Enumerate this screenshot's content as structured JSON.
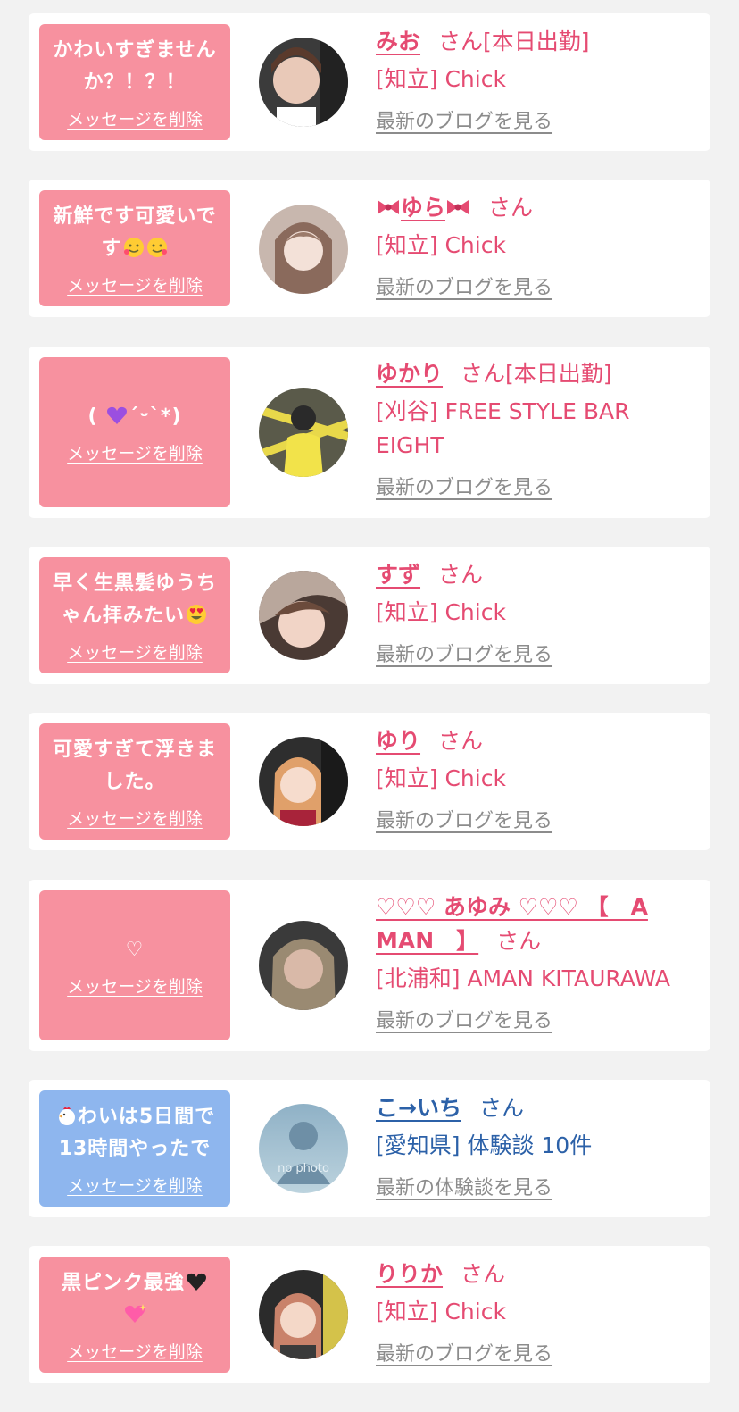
{
  "colors": {
    "background": "#f2f2f2",
    "card": "#ffffff",
    "bubble_pink": "#f7919f",
    "bubble_blue": "#8eb6ee",
    "accent_pink": "#e54b72",
    "accent_blue": "#2c61a8",
    "link_gray": "#8c8c8c"
  },
  "cards": [
    {
      "message_lines": [
        "かわいすぎません",
        "か？！？！"
      ],
      "delete_label": "メッセージを削除",
      "name": "みお",
      "san_label": "さん[本日出勤]",
      "shop_lines": [
        "[知立] Chick"
      ],
      "blog_label": "最新のブログを見る",
      "avatar_icon": "photo-avatar"
    },
    {
      "message_lines": [
        "新鮮です可愛いで",
        "す"
      ],
      "message_emoji": "smiling-face-with-hearts x2",
      "delete_label": "メッセージを削除",
      "name": "ゆら",
      "name_decor": "ribbon-bow-icon",
      "san_label": "さん",
      "shop_lines": [
        "[知立] Chick"
      ],
      "blog_label": "最新のブログを見る",
      "avatar_icon": "photo-avatar"
    },
    {
      "message_lines": [
        "(   ´ᵕ`*)"
      ],
      "message_emoji": "purple-heart-icon",
      "delete_label": "メッセージを削除",
      "name": "ゆかり",
      "san_label": "さん[本日出勤]",
      "shop_lines": [
        "[刈谷] FREE STYLE BAR",
        "EIGHT"
      ],
      "blog_label": "最新のブログを見る",
      "avatar_icon": "photo-avatar"
    },
    {
      "message_lines": [
        "早く生黒髪ゆうち",
        "ゃん拝みたい"
      ],
      "message_emoji": "heart-eyes-icon",
      "delete_label": "メッセージを削除",
      "name": "すず",
      "san_label": "さん",
      "shop_lines": [
        "[知立] Chick"
      ],
      "blog_label": "最新のブログを見る",
      "avatar_icon": "photo-avatar"
    },
    {
      "message_lines": [
        "可愛すぎて浮きま",
        "した。"
      ],
      "delete_label": "メッセージを削除",
      "name": "ゆり",
      "san_label": "さん",
      "shop_lines": [
        "[知立] Chick"
      ],
      "blog_label": "最新のブログを見る",
      "avatar_icon": "photo-avatar"
    },
    {
      "message_lines": [
        "♡"
      ],
      "delete_label": "メッセージを削除",
      "name_lines": [
        "♡♡♡ あゆみ ♡♡♡ 【　A",
        "MAN　】"
      ],
      "san_label": "さん",
      "shop_lines": [
        "[北浦和] AMAN KITAURAWA"
      ],
      "blog_label": "最新のブログを見る",
      "avatar_icon": "photo-avatar"
    },
    {
      "message_lines": [
        "わいは5日間で",
        "13時間やったで"
      ],
      "message_emoji": "rooster-icon",
      "delete_label": "メッセージを削除",
      "name": "こ→いち",
      "san_label": "さん",
      "shop_lines": [
        "[愛知県] 体験談 10件"
      ],
      "blog_label": "最新の体験談を見る",
      "avatar_caption": "no photo",
      "avatar_icon": "no-photo-silhouette"
    },
    {
      "message_lines": [
        "黒ピンク最強",
        ""
      ],
      "message_emoji": "black-heart + sparkling-heart",
      "delete_label": "メッセージを削除",
      "name": "りりか",
      "san_label": "さん",
      "shop_lines": [
        "[知立] Chick"
      ],
      "blog_label": "最新のブログを見る",
      "avatar_icon": "photo-avatar"
    }
  ]
}
